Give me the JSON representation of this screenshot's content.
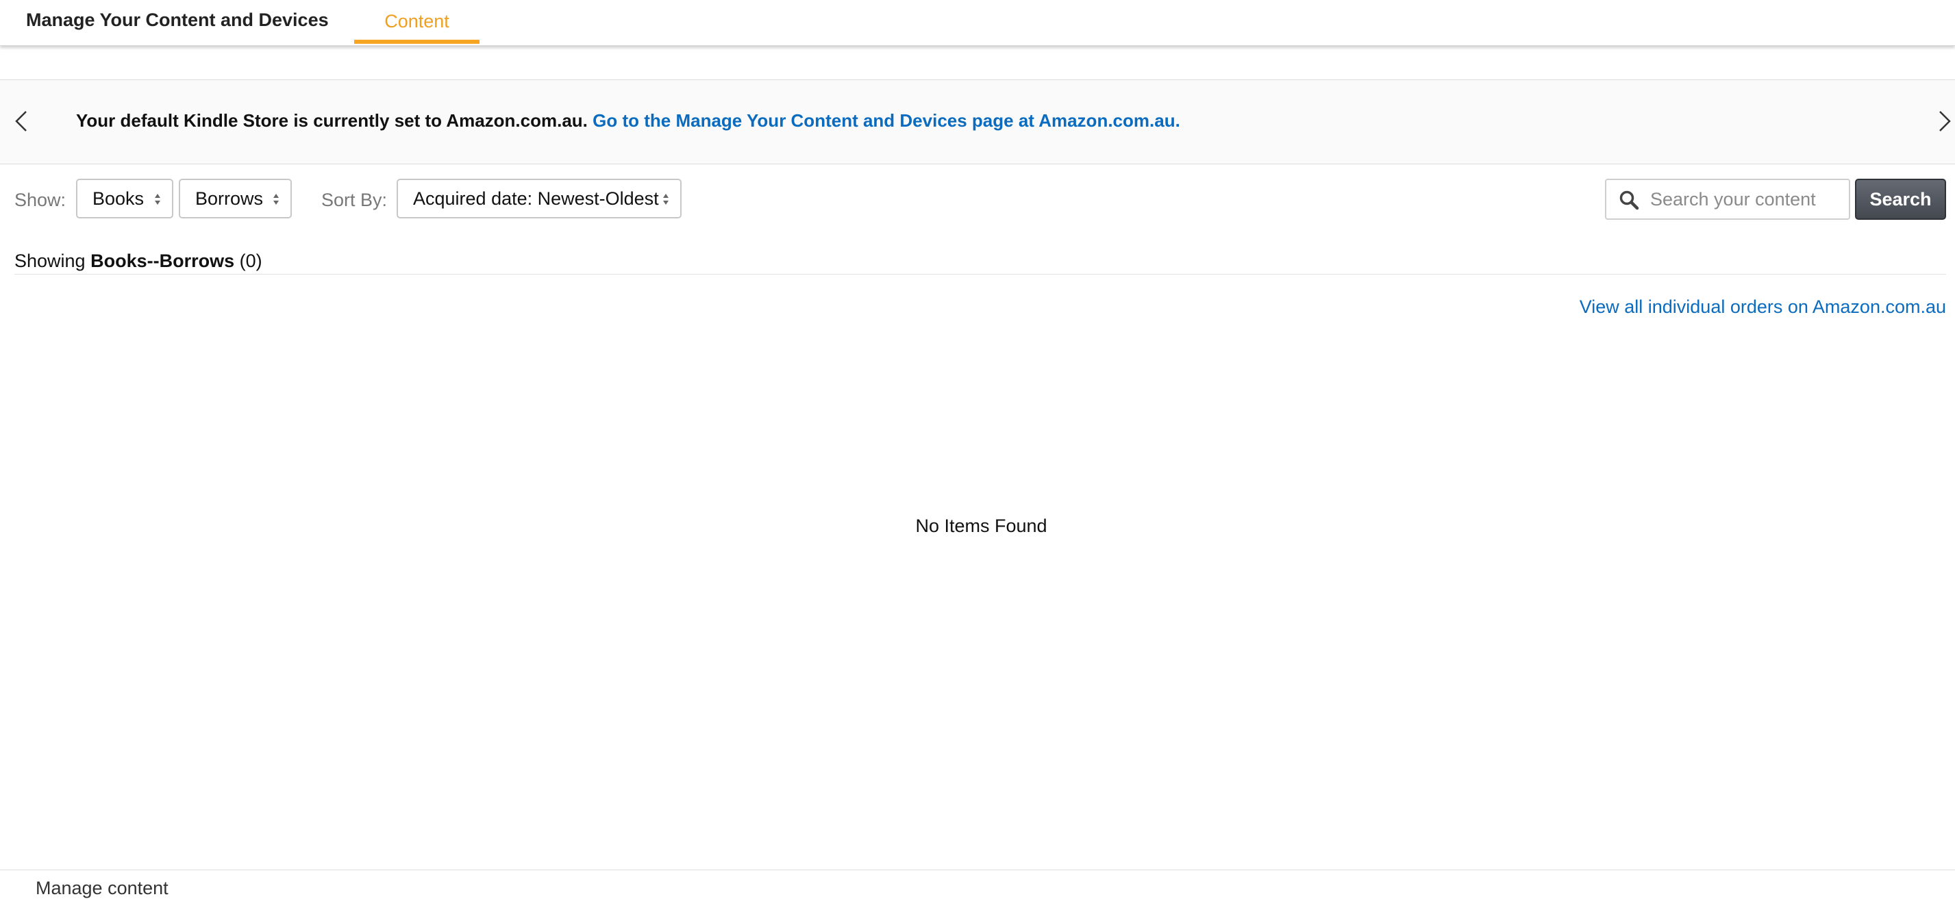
{
  "nav": {
    "title": "Manage Your Content and Devices",
    "tab_content": "Content",
    "accent_color": "#f6a623"
  },
  "banner": {
    "message": "Your default Kindle Store is currently set to Amazon.com.au.",
    "link": "Go to the Manage Your Content and Devices page at Amazon.com.au."
  },
  "filters": {
    "show_label": "Show:",
    "type_selected": "Books",
    "subtype_selected": "Borrows",
    "sort_label": "Sort By:",
    "sort_selected": "Acquired date: Newest-Oldest"
  },
  "search": {
    "placeholder": "Search your content",
    "button": "Search"
  },
  "results": {
    "prefix": "Showing",
    "category": "Books--Borrows",
    "count": "(0)",
    "orders_link": "View all individual orders on Amazon.com.au",
    "empty_message": "No Items Found"
  },
  "footer": {
    "text": "Manage content"
  }
}
